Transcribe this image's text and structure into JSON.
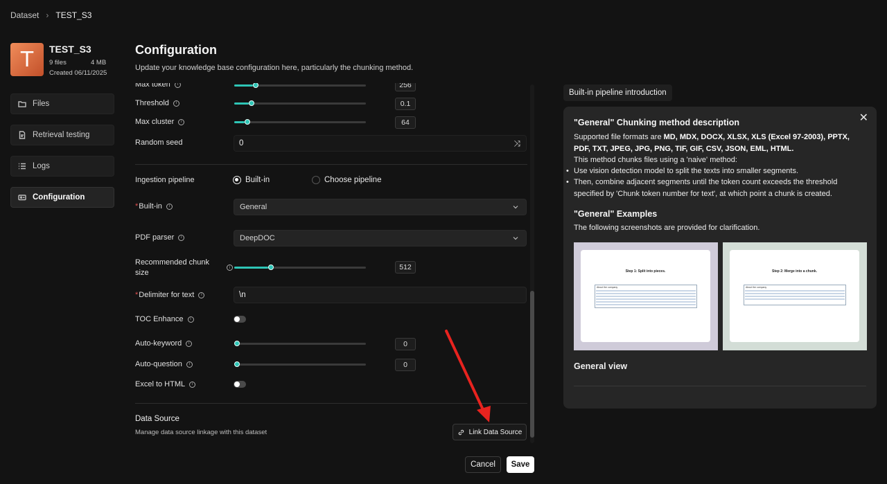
{
  "breadcrumb": {
    "root": "Dataset",
    "current": "TEST_S3"
  },
  "dataset": {
    "avatar_letter": "T",
    "name": "TEST_S3",
    "files": "9 files",
    "size": "4 MB",
    "created": "Created 06/11/2025"
  },
  "nav": {
    "items": [
      {
        "label": "Files",
        "icon": "folder-icon"
      },
      {
        "label": "Retrieval testing",
        "icon": "file-search-icon"
      },
      {
        "label": "Logs",
        "icon": "list-icon"
      },
      {
        "label": "Configuration",
        "icon": "config-icon",
        "active": true
      }
    ]
  },
  "header": {
    "title": "Configuration",
    "subtitle": "Update your knowledge base configuration here, particularly the chunking method."
  },
  "form": {
    "max_token": {
      "label": "Max token",
      "value": "256",
      "level": 0.14
    },
    "threshold": {
      "label": "Threshold",
      "value": "0.1",
      "level": 0.11
    },
    "max_cluster": {
      "label": "Max cluster",
      "value": "64",
      "level": 0.08
    },
    "random_seed": {
      "label": "Random seed",
      "value": "0"
    },
    "ingestion": {
      "label": "Ingestion pipeline",
      "option_builtin": "Built-in",
      "option_choose": "Choose pipeline",
      "selected": "Built-in"
    },
    "builtin": {
      "label": "Built-in",
      "value": "General"
    },
    "pdf_parser": {
      "label": "PDF parser",
      "value": "DeepDOC"
    },
    "chunk_size": {
      "label": "Recommended chunk size",
      "value": "512",
      "level": 0.26
    },
    "delimiter": {
      "label": "Delimiter for text",
      "value": "\\n"
    },
    "toc": {
      "label": "TOC Enhance",
      "enabled": false
    },
    "auto_keyword": {
      "label": "Auto-keyword",
      "value": "0",
      "level": 0
    },
    "auto_question": {
      "label": "Auto-question",
      "value": "0",
      "level": 0
    },
    "excel_html": {
      "label": "Excel to HTML",
      "enabled": false
    },
    "data_source": {
      "title": "Data Source",
      "description": "Manage data source linkage with this dataset",
      "button": "Link Data Source"
    }
  },
  "footer": {
    "cancel": "Cancel",
    "save": "Save"
  },
  "intro": {
    "tag": "Built-in pipeline introduction",
    "heading": "\"General\" Chunking method description",
    "formats_prefix": "Supported file formats are ",
    "formats": "MD, MDX, DOCX, XLSX, XLS (Excel 97-2003), PPTX, PDF, TXT, JPEG, JPG, PNG, TIF, GIF, CSV, JSON, EML, HTML.",
    "method_line": "This method chunks files using a 'naive' method:",
    "bullet1": "Use vision detection model to split the texts into smaller segments.",
    "bullet2": "Then, combine adjacent segments until the token count exceeds the threshold specified by 'Chunk token number for text', at which point a chunk is created.",
    "examples_heading": "\"General\" Examples",
    "examples_text": "The following screenshots are provided for clarification.",
    "shot1_caption": "Step 1: Split into pieces.",
    "shot2_caption": "Step 2: Merge into a chunk.",
    "shot_box_title": "About the company",
    "view_heading": "General view"
  },
  "colors": {
    "accent": "#2ec5b6",
    "arrow": "#e8231f",
    "avatar": "#e07a48"
  }
}
